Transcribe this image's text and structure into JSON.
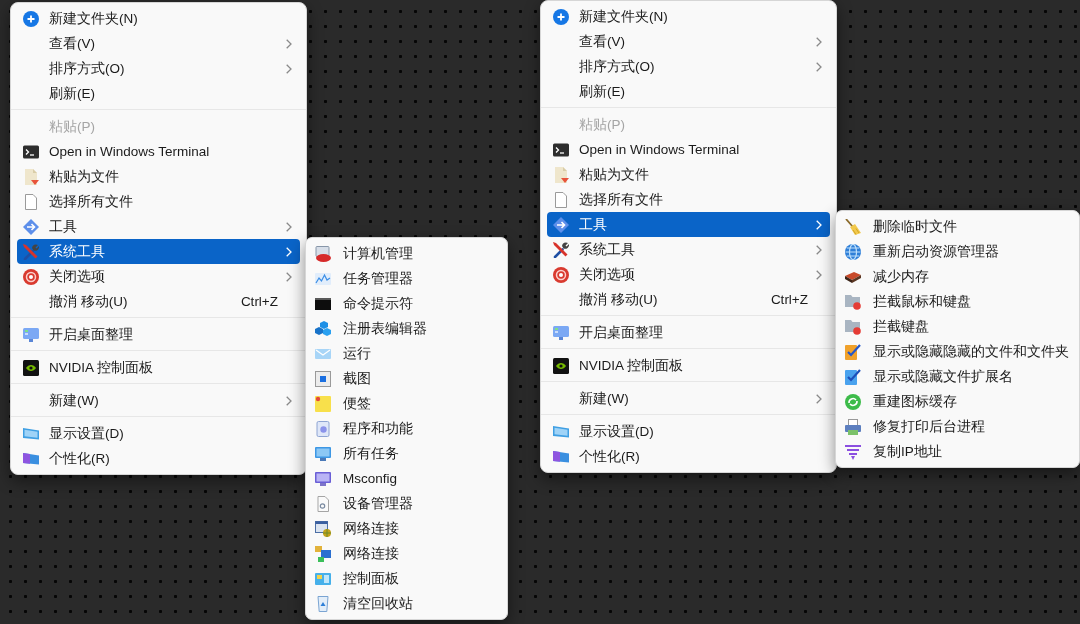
{
  "screens": [
    {
      "context_menu": {
        "groups": [
          [
            {
              "label": "新建文件夹(N)",
              "selected": false,
              "disabled": false,
              "has_submenu": false
            },
            {
              "label": "查看(V)",
              "selected": false,
              "disabled": false,
              "has_submenu": true
            },
            {
              "label": "排序方式(O)",
              "selected": false,
              "disabled": false,
              "has_submenu": true
            },
            {
              "label": "刷新(E)",
              "selected": false,
              "disabled": false,
              "has_submenu": false
            }
          ],
          [
            {
              "label": "粘贴(P)",
              "selected": false,
              "disabled": true,
              "has_submenu": false
            },
            {
              "label": "Open in Windows Terminal",
              "selected": false,
              "disabled": false,
              "has_submenu": false
            },
            {
              "label": "粘贴为文件",
              "selected": false,
              "disabled": false,
              "has_submenu": false
            },
            {
              "label": "选择所有文件",
              "selected": false,
              "disabled": false,
              "has_submenu": false
            },
            {
              "label": "工具",
              "selected": false,
              "disabled": false,
              "has_submenu": true
            },
            {
              "label": "系统工具",
              "selected": true,
              "disabled": false,
              "has_submenu": true
            },
            {
              "label": "关闭选项",
              "selected": false,
              "disabled": false,
              "has_submenu": true
            },
            {
              "label": "撤消 移动(U)",
              "shortcut": "Ctrl+Z",
              "selected": false,
              "disabled": false,
              "has_submenu": false
            }
          ],
          [
            {
              "label": "开启桌面整理",
              "selected": false,
              "disabled": false,
              "has_submenu": false
            }
          ],
          [
            {
              "label": "NVIDIA 控制面板",
              "selected": false,
              "disabled": false,
              "has_submenu": false
            }
          ],
          [
            {
              "label": "新建(W)",
              "selected": false,
              "disabled": false,
              "has_submenu": true
            }
          ],
          [
            {
              "label": "显示设置(D)",
              "selected": false,
              "disabled": false,
              "has_submenu": false
            },
            {
              "label": "个性化(R)",
              "selected": false,
              "disabled": false,
              "has_submenu": false
            }
          ]
        ]
      },
      "submenu": {
        "items": [
          {
            "label": "计算机管理",
            "selected": false
          },
          {
            "label": "任务管理器",
            "selected": false
          },
          {
            "label": "命令提示符",
            "selected": false
          },
          {
            "label": "注册表编辑器",
            "selected": false
          },
          {
            "label": "运行",
            "selected": false
          },
          {
            "label": "截图",
            "selected": false
          },
          {
            "label": "便签",
            "selected": false
          },
          {
            "label": "程序和功能",
            "selected": false
          },
          {
            "label": "所有任务",
            "selected": false
          },
          {
            "label": "Msconfig",
            "selected": false
          },
          {
            "label": "设备管理器",
            "selected": false
          },
          {
            "label": "网络连接",
            "selected": false
          },
          {
            "label": "网络连接",
            "selected": false
          },
          {
            "label": "控制面板",
            "selected": false
          },
          {
            "label": "清空回收站",
            "selected": false
          }
        ]
      }
    },
    {
      "context_menu": {
        "groups": [
          [
            {
              "label": "新建文件夹(N)",
              "selected": false,
              "disabled": false,
              "has_submenu": false
            },
            {
              "label": "查看(V)",
              "selected": false,
              "disabled": false,
              "has_submenu": true
            },
            {
              "label": "排序方式(O)",
              "selected": false,
              "disabled": false,
              "has_submenu": true
            },
            {
              "label": "刷新(E)",
              "selected": false,
              "disabled": false,
              "has_submenu": false
            }
          ],
          [
            {
              "label": "粘贴(P)",
              "selected": false,
              "disabled": true,
              "has_submenu": false
            },
            {
              "label": "Open in Windows Terminal",
              "selected": false,
              "disabled": false,
              "has_submenu": false
            },
            {
              "label": "粘贴为文件",
              "selected": false,
              "disabled": false,
              "has_submenu": false
            },
            {
              "label": "选择所有文件",
              "selected": false,
              "disabled": false,
              "has_submenu": false
            },
            {
              "label": "工具",
              "selected": true,
              "disabled": false,
              "has_submenu": true
            },
            {
              "label": "系统工具",
              "selected": false,
              "disabled": false,
              "has_submenu": true
            },
            {
              "label": "关闭选项",
              "selected": false,
              "disabled": false,
              "has_submenu": true
            },
            {
              "label": "撤消 移动(U)",
              "shortcut": "Ctrl+Z",
              "selected": false,
              "disabled": false,
              "has_submenu": false
            }
          ],
          [
            {
              "label": "开启桌面整理",
              "selected": false,
              "disabled": false,
              "has_submenu": false
            }
          ],
          [
            {
              "label": "NVIDIA 控制面板",
              "selected": false,
              "disabled": false,
              "has_submenu": false
            }
          ],
          [
            {
              "label": "新建(W)",
              "selected": false,
              "disabled": false,
              "has_submenu": true
            }
          ],
          [
            {
              "label": "显示设置(D)",
              "selected": false,
              "disabled": false,
              "has_submenu": false
            },
            {
              "label": "个性化(R)",
              "selected": false,
              "disabled": false,
              "has_submenu": false
            }
          ]
        ]
      },
      "submenu": {
        "items": [
          {
            "label": "删除临时文件",
            "selected": false
          },
          {
            "label": "重新启动资源管理器",
            "selected": false
          },
          {
            "label": "减少内存",
            "selected": false
          },
          {
            "label": "拦截鼠标和键盘",
            "selected": false
          },
          {
            "label": "拦截键盘",
            "selected": false
          },
          {
            "label": "显示或隐藏隐藏的文件和文件夹",
            "selected": false
          },
          {
            "label": "显示或隐藏文件扩展名",
            "selected": false
          },
          {
            "label": "重建图标缓存",
            "selected": false
          },
          {
            "label": "修复打印后台进程",
            "selected": false
          },
          {
            "label": "复制IP地址",
            "selected": false
          }
        ]
      }
    }
  ]
}
